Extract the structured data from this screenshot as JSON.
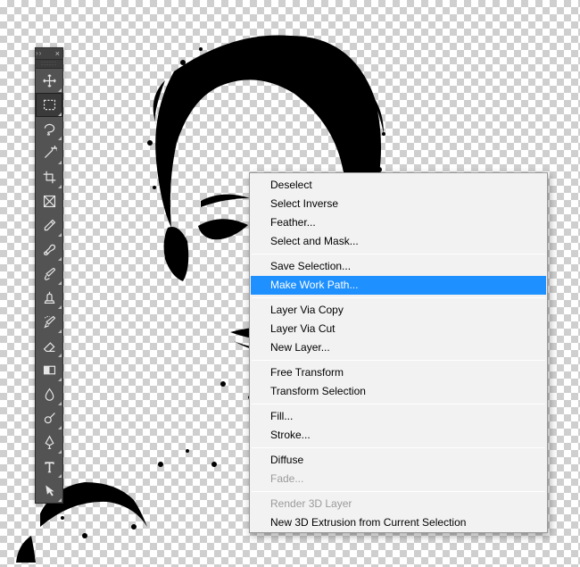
{
  "tool_panel": {
    "header_x": "×",
    "tools": [
      {
        "name": "move-tool",
        "selected": false,
        "flyout": true
      },
      {
        "name": "rectangular-marquee-tool",
        "selected": true,
        "flyout": true
      },
      {
        "name": "lasso-tool",
        "selected": false,
        "flyout": true
      },
      {
        "name": "magic-wand-tool",
        "selected": false,
        "flyout": true
      },
      {
        "name": "crop-tool",
        "selected": false,
        "flyout": true
      },
      {
        "name": "frame-tool",
        "selected": false,
        "flyout": false
      },
      {
        "name": "eyedropper-tool",
        "selected": false,
        "flyout": true
      },
      {
        "name": "spot-healing-brush-tool",
        "selected": false,
        "flyout": true
      },
      {
        "name": "brush-tool",
        "selected": false,
        "flyout": true
      },
      {
        "name": "clone-stamp-tool",
        "selected": false,
        "flyout": true
      },
      {
        "name": "history-brush-tool",
        "selected": false,
        "flyout": true
      },
      {
        "name": "eraser-tool",
        "selected": false,
        "flyout": true
      },
      {
        "name": "gradient-tool",
        "selected": false,
        "flyout": true
      },
      {
        "name": "blur-tool",
        "selected": false,
        "flyout": true
      },
      {
        "name": "dodge-tool",
        "selected": false,
        "flyout": true
      },
      {
        "name": "pen-tool",
        "selected": false,
        "flyout": true
      },
      {
        "name": "type-tool",
        "selected": false,
        "flyout": true
      },
      {
        "name": "path-selection-tool",
        "selected": false,
        "flyout": true
      }
    ]
  },
  "context_menu": {
    "items": [
      {
        "label": "Deselect",
        "type": "item"
      },
      {
        "label": "Select Inverse",
        "type": "item"
      },
      {
        "label": "Feather...",
        "type": "item"
      },
      {
        "label": "Select and Mask...",
        "type": "item"
      },
      {
        "type": "sep"
      },
      {
        "label": "Save Selection...",
        "type": "item"
      },
      {
        "label": "Make Work Path...",
        "type": "item",
        "highlight": true
      },
      {
        "type": "sep"
      },
      {
        "label": "Layer Via Copy",
        "type": "item"
      },
      {
        "label": "Layer Via Cut",
        "type": "item"
      },
      {
        "label": "New Layer...",
        "type": "item"
      },
      {
        "type": "sep"
      },
      {
        "label": "Free Transform",
        "type": "item"
      },
      {
        "label": "Transform Selection",
        "type": "item"
      },
      {
        "type": "sep"
      },
      {
        "label": "Fill...",
        "type": "item"
      },
      {
        "label": "Stroke...",
        "type": "item"
      },
      {
        "type": "sep"
      },
      {
        "label": "Diffuse",
        "type": "item"
      },
      {
        "label": "Fade...",
        "type": "item",
        "disabled": true
      },
      {
        "type": "sep"
      },
      {
        "label": "Render 3D Layer",
        "type": "item",
        "disabled": true
      },
      {
        "label": "New 3D Extrusion from Current Selection",
        "type": "item"
      }
    ]
  }
}
